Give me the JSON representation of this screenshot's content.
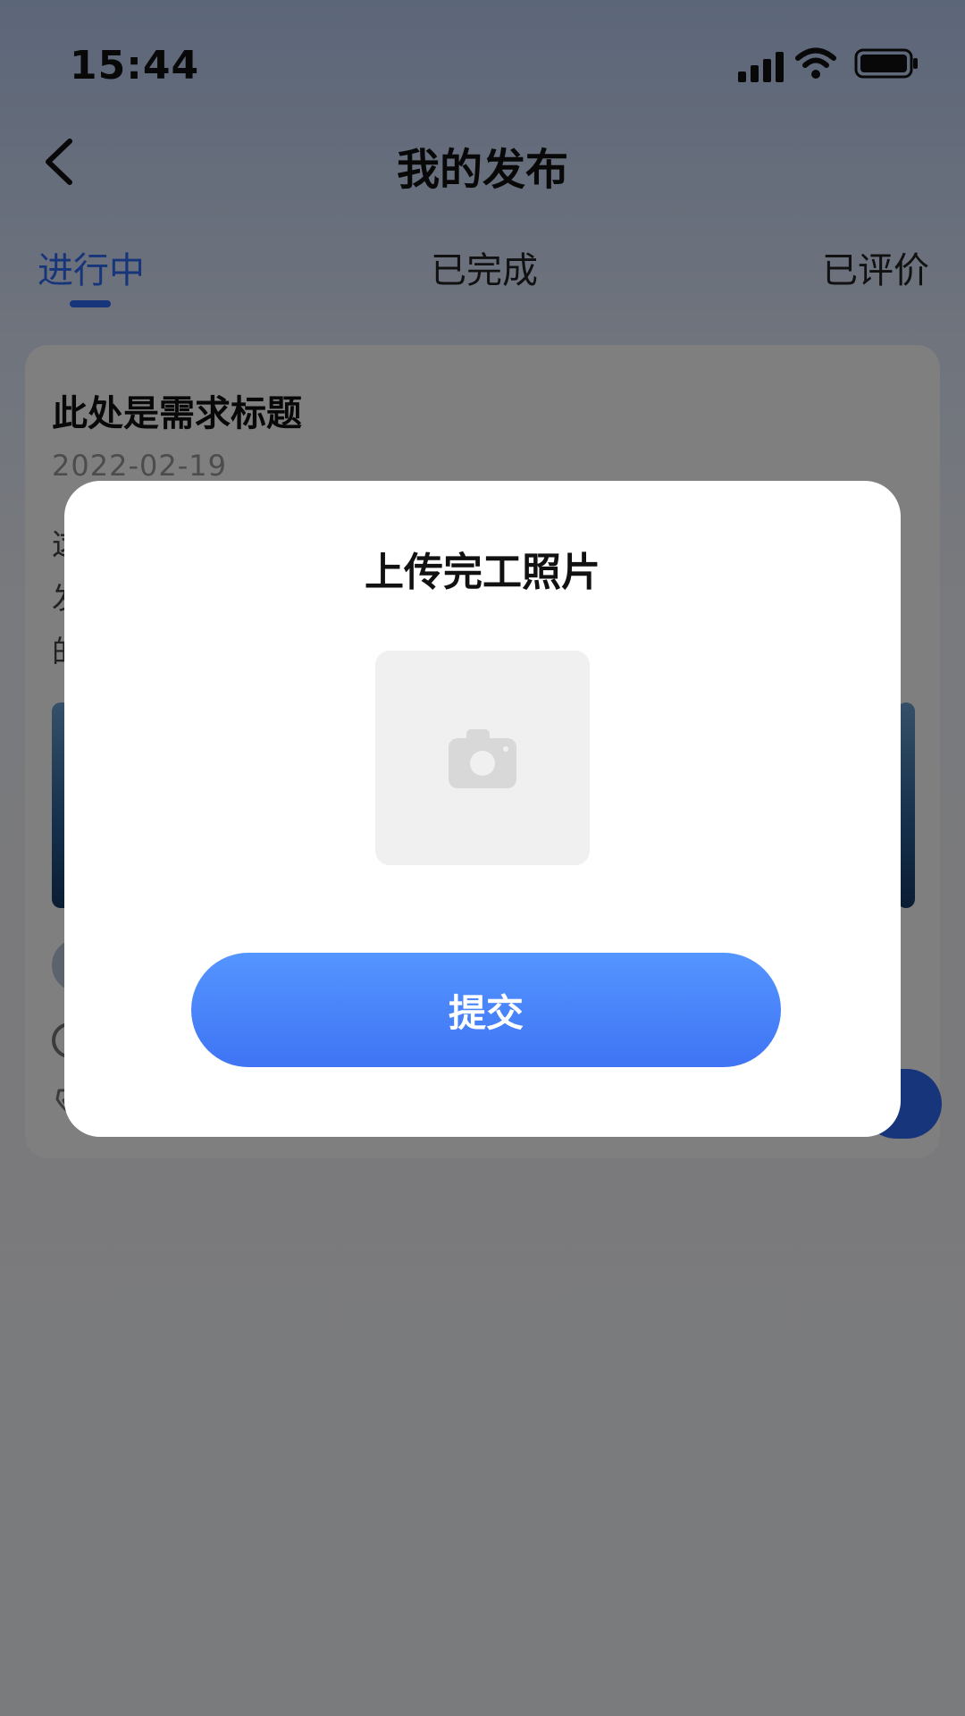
{
  "status_bar": {
    "time": "15:44"
  },
  "nav": {
    "title": "我的发布"
  },
  "tabs": [
    {
      "label": "进行中",
      "active": true
    },
    {
      "label": "已完成",
      "active": false
    },
    {
      "label": "已评价",
      "active": false
    }
  ],
  "card": {
    "title": "此处是需求标题",
    "date": "2022-02-19",
    "desc_lines": [
      "这",
      "发",
      "的"
    ]
  },
  "modal": {
    "title": "上传完工照片",
    "submit_label": "提交"
  },
  "colors": {
    "accent": "#2f6bf5",
    "overlay": "rgba(0,0,0,0.5)"
  },
  "icons": [
    "back-arrow-icon",
    "signal-icon",
    "wifi-icon",
    "battery-icon",
    "camera-icon"
  ]
}
